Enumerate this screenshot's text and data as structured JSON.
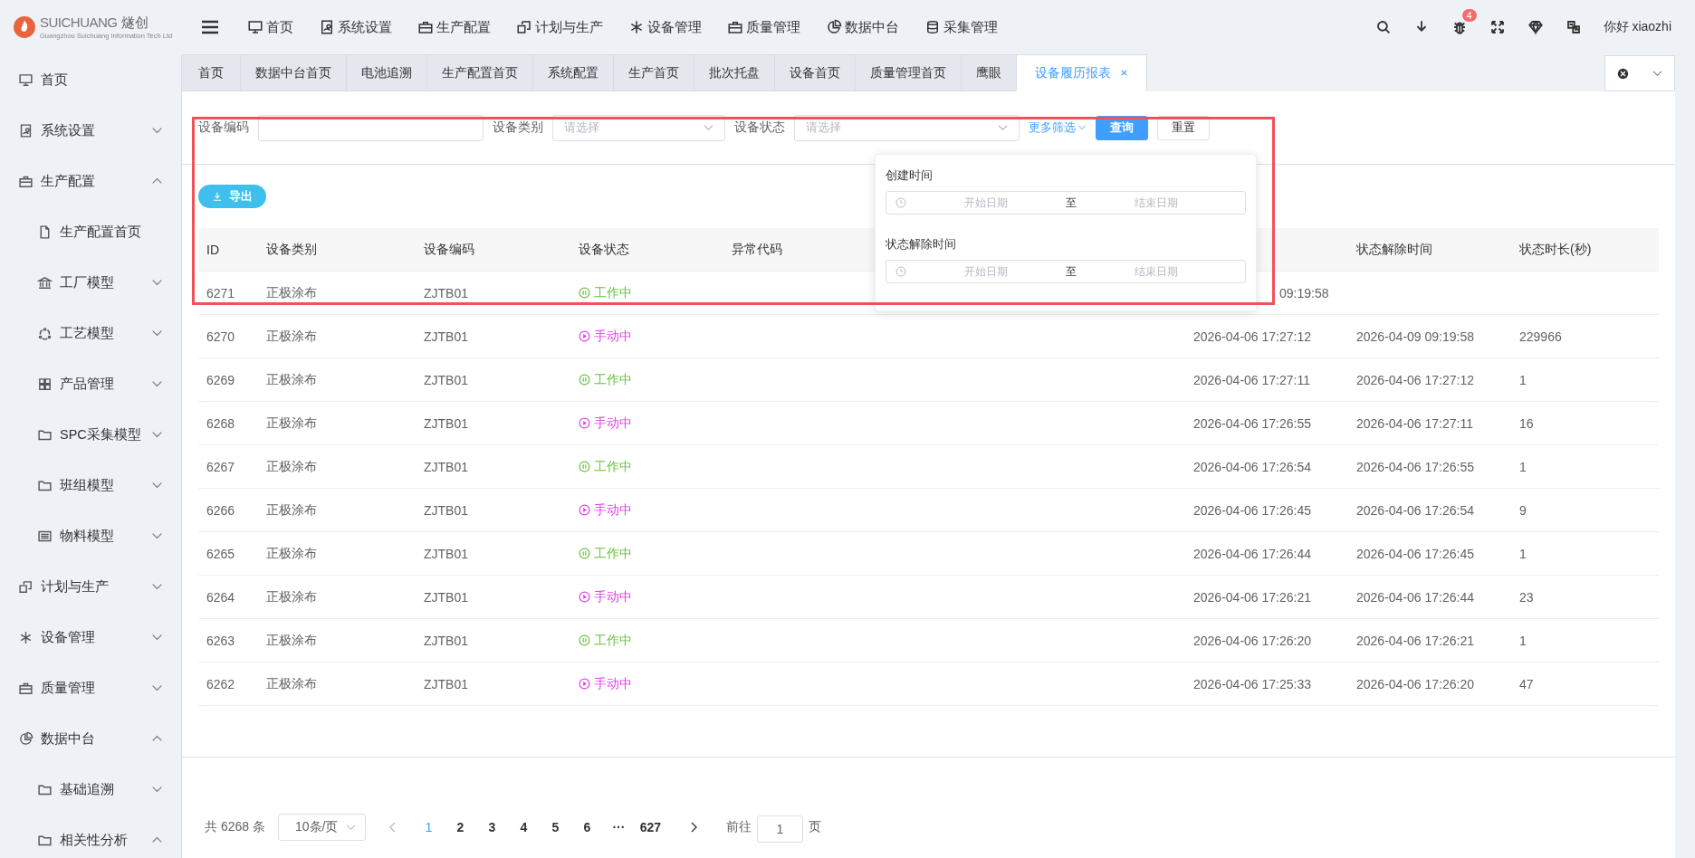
{
  "brand": {
    "name": "SUICHUANG",
    "name_cn": "燧创",
    "tagline": "Guangzhou Suichuang Information Tech Ltd"
  },
  "top_nav": [
    {
      "label": "首页"
    },
    {
      "label": "系统设置"
    },
    {
      "label": "生产配置"
    },
    {
      "label": "计划与生产"
    },
    {
      "label": "设备管理"
    },
    {
      "label": "质量管理"
    },
    {
      "label": "数据中台"
    },
    {
      "label": "采集管理"
    }
  ],
  "notifications": {
    "count": "4"
  },
  "user": {
    "greeting": "你好 xiaozhi"
  },
  "sidebar": {
    "items": [
      {
        "label": "首页",
        "kind": "page"
      },
      {
        "label": "系统设置",
        "kind": "menu",
        "expanded": false
      },
      {
        "label": "生产配置",
        "kind": "menu",
        "expanded": true,
        "children": [
          {
            "label": "生产配置首页",
            "kind": "page"
          },
          {
            "label": "工厂模型",
            "kind": "menu",
            "expanded": false
          },
          {
            "label": "工艺模型",
            "kind": "menu",
            "expanded": false
          },
          {
            "label": "产品管理",
            "kind": "menu",
            "expanded": false
          },
          {
            "label": "SPC采集模型",
            "kind": "menu",
            "expanded": false
          },
          {
            "label": "班组模型",
            "kind": "menu",
            "expanded": false
          },
          {
            "label": "物料模型",
            "kind": "menu",
            "expanded": false
          }
        ]
      },
      {
        "label": "计划与生产",
        "kind": "menu",
        "expanded": false
      },
      {
        "label": "设备管理",
        "kind": "menu",
        "expanded": false
      },
      {
        "label": "质量管理",
        "kind": "menu",
        "expanded": false
      },
      {
        "label": "数据中台",
        "kind": "menu",
        "expanded": true,
        "children": [
          {
            "label": "基础追溯",
            "kind": "menu",
            "expanded": false
          },
          {
            "label": "相关性分析",
            "kind": "menu",
            "expanded": true
          }
        ]
      }
    ]
  },
  "tabs": [
    {
      "label": "首页",
      "selected": false
    },
    {
      "label": "数据中台首页",
      "selected": false
    },
    {
      "label": "电池追溯",
      "selected": false
    },
    {
      "label": "生产配置首页",
      "selected": false
    },
    {
      "label": "系统配置",
      "selected": false
    },
    {
      "label": "生产首页",
      "selected": false
    },
    {
      "label": "批次托盘",
      "selected": false
    },
    {
      "label": "设备首页",
      "selected": false
    },
    {
      "label": "质量管理首页",
      "selected": false
    },
    {
      "label": "鹰眼",
      "selected": false
    },
    {
      "label": "设备履历报表",
      "selected": true
    }
  ],
  "filters": [
    {
      "label": "设备编码",
      "kind": "input"
    },
    {
      "label": "设备类别",
      "kind": "select",
      "placeholder": "请选择"
    },
    {
      "label": "设备状态",
      "kind": "select",
      "placeholder": "请选择"
    }
  ],
  "more_filters": {
    "label": "更多筛选",
    "expanded": true,
    "fields": [
      {
        "label": "创建时间",
        "start_placeholder": "开始日期",
        "separator": "至",
        "end_placeholder": "结束日期"
      },
      {
        "label": "状态解除时间",
        "start_placeholder": "开始日期",
        "separator": "至",
        "end_placeholder": "结束日期"
      }
    ]
  },
  "buttons": {
    "search": "查询",
    "reset": "重置",
    "export": "导出"
  },
  "table": {
    "columns": [
      {
        "label": "ID"
      },
      {
        "label": "设备类别"
      },
      {
        "label": "设备编码"
      },
      {
        "label": "设备状态"
      },
      {
        "label": "异常代码"
      },
      {},
      {},
      {
        "label": "状态解除时间"
      },
      {
        "label": "状态时长(秒)"
      }
    ],
    "rows": [
      {
        "id": "6271",
        "category": "正极涂布",
        "code": "ZJTB01",
        "status": "工作中",
        "manual_mode": false,
        "created": "09:19:58"
      },
      {
        "id": "6270",
        "category": "正极涂布",
        "code": "ZJTB01",
        "status": "手动中",
        "manual_mode": true,
        "created": "2026-04-06 17:27:12",
        "resolved": "2026-04-09 09:19:58",
        "duration": "229966"
      },
      {
        "id": "6269",
        "category": "正极涂布",
        "code": "ZJTB01",
        "status": "工作中",
        "manual_mode": false,
        "created": "2026-04-06 17:27:11",
        "resolved": "2026-04-06 17:27:12",
        "duration": "1"
      },
      {
        "id": "6268",
        "category": "正极涂布",
        "code": "ZJTB01",
        "status": "手动中",
        "manual_mode": true,
        "created": "2026-04-06 17:26:55",
        "resolved": "2026-04-06 17:27:11",
        "duration": "16"
      },
      {
        "id": "6267",
        "category": "正极涂布",
        "code": "ZJTB01",
        "status": "工作中",
        "manual_mode": false,
        "created": "2026-04-06 17:26:54",
        "resolved": "2026-04-06 17:26:55",
        "duration": "1"
      },
      {
        "id": "6266",
        "category": "正极涂布",
        "code": "ZJTB01",
        "status": "手动中",
        "manual_mode": true,
        "created": "2026-04-06 17:26:45",
        "resolved": "2026-04-06 17:26:54",
        "duration": "9"
      },
      {
        "id": "6265",
        "category": "正极涂布",
        "code": "ZJTB01",
        "status": "工作中",
        "manual_mode": false,
        "created": "2026-04-06 17:26:44",
        "resolved": "2026-04-06 17:26:45",
        "duration": "1"
      },
      {
        "id": "6264",
        "category": "正极涂布",
        "code": "ZJTB01",
        "status": "手动中",
        "manual_mode": true,
        "created": "2026-04-06 17:26:21",
        "resolved": "2026-04-06 17:26:44",
        "duration": "23"
      },
      {
        "id": "6263",
        "category": "正极涂布",
        "code": "ZJTB01",
        "status": "工作中",
        "manual_mode": false,
        "created": "2026-04-06 17:26:20",
        "resolved": "2026-04-06 17:26:21",
        "duration": "1"
      },
      {
        "id": "6262",
        "category": "正极涂布",
        "code": "ZJTB01",
        "status": "手动中",
        "manual_mode": true,
        "created": "2026-04-06 17:25:33",
        "resolved": "2026-04-06 17:26:20",
        "duration": "47"
      }
    ]
  },
  "pagination": {
    "total": "共 6268 条",
    "page_size": "10条/页",
    "pages": [
      {
        "label": "1",
        "selected": true
      },
      {
        "label": "2",
        "selected": false
      },
      {
        "label": "3",
        "selected": false
      },
      {
        "label": "4",
        "selected": false
      },
      {
        "label": "5",
        "selected": false
      },
      {
        "label": "6",
        "selected": false
      },
      {
        "label": "···",
        "selected": false
      },
      {
        "label": "627",
        "selected": false
      }
    ],
    "goto_label": "前往",
    "goto_value": "1",
    "goto_suffix": "页"
  }
}
